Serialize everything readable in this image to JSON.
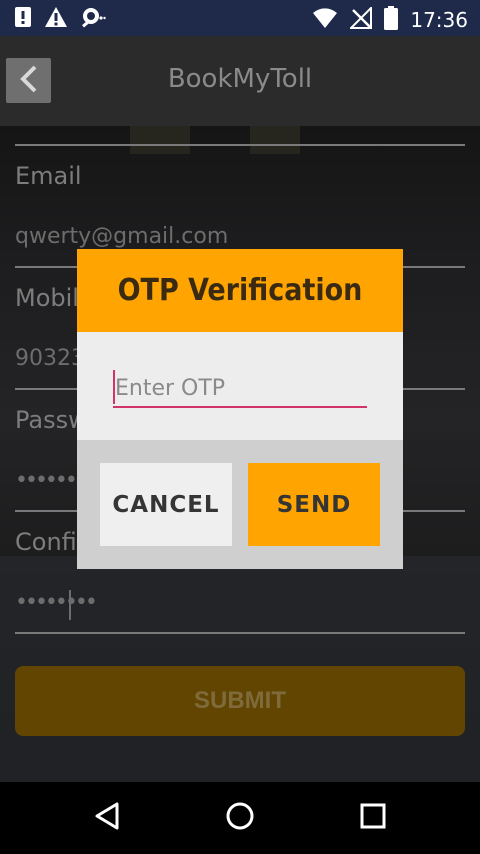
{
  "status_bar": {
    "time": "17:36",
    "icons": [
      "sim-alert-icon",
      "warning-icon",
      "location-search-icon",
      "wifi-icon",
      "no-signal-icon",
      "battery-icon"
    ]
  },
  "toolbar": {
    "title": "BookMyToll",
    "back_icon": "back-arrow-icon"
  },
  "form": {
    "email_label": "Email",
    "email_value": "qwerty@gmail.com",
    "mobile_label": "Mobil",
    "mobile_value": "90323",
    "password_label": "Passw",
    "password_value": "•••••••••",
    "confirm_label": "Confir",
    "confirm_value": "••••••••",
    "submit_label": "SUBMIT"
  },
  "dialog": {
    "title": "OTP Verification",
    "otp_placeholder": "Enter OTP",
    "otp_value": "",
    "cancel_label": "CANCEL",
    "send_label": "SEND"
  },
  "nav_bar": {
    "icons": [
      "back-triangle-icon",
      "home-circle-icon",
      "recents-square-icon"
    ]
  },
  "colors": {
    "accent": "#ffa400",
    "status_bar": "#1f2a4a",
    "toolbar": "#2b2b2b",
    "input_underline": "#d2336a"
  }
}
